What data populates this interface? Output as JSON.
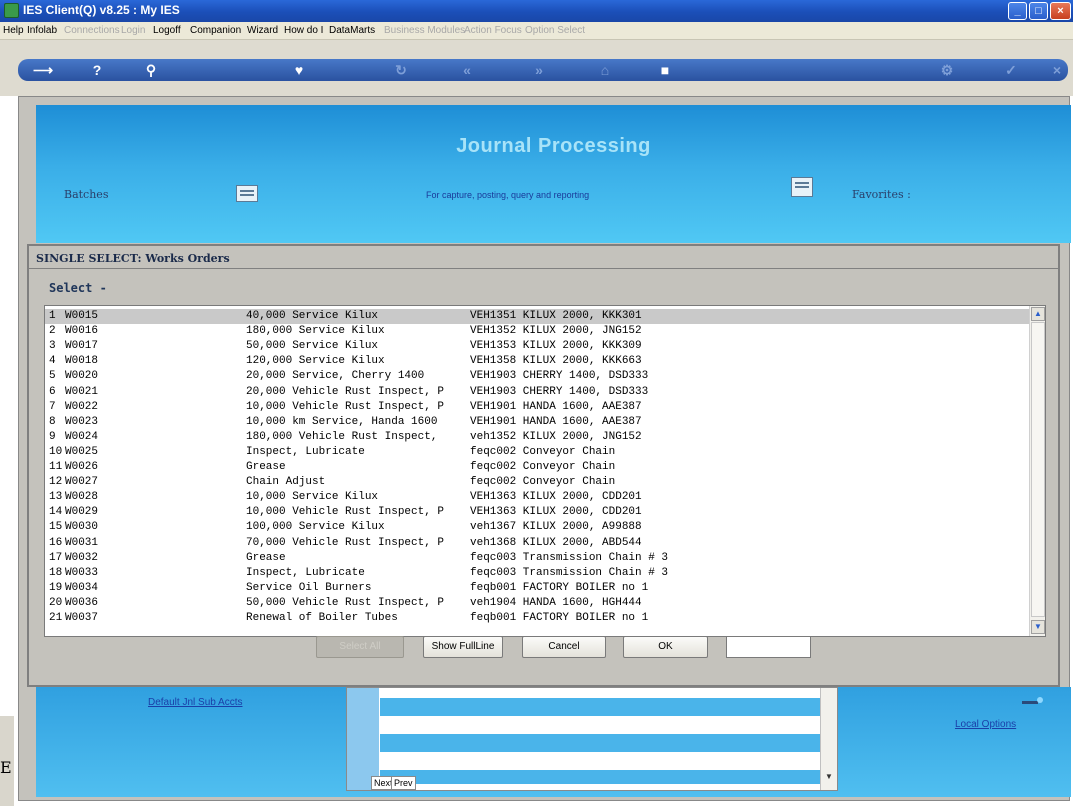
{
  "window": {
    "title": "IES Client(Q) v8.25 : My IES"
  },
  "menu": [
    {
      "label": "Help",
      "enabled": true
    },
    {
      "label": "Infolab",
      "enabled": true
    },
    {
      "label": "Connections",
      "enabled": false
    },
    {
      "label": "Login",
      "enabled": false
    },
    {
      "label": "Logoff",
      "enabled": true
    },
    {
      "label": "Companion",
      "enabled": true
    },
    {
      "label": "Wizard",
      "enabled": true
    },
    {
      "label": "How do I",
      "enabled": true
    },
    {
      "label": "DataMarts",
      "enabled": true
    },
    {
      "label": "Business Modules",
      "enabled": false
    },
    {
      "label": "Action Focus",
      "enabled": false
    },
    {
      "label": "Option Select",
      "enabled": false
    }
  ],
  "toolbar_icons": [
    "arrow-icon",
    "help-icon",
    "search-icon",
    "heart-icon",
    "refresh-icon",
    "back-icon",
    "forward-icon",
    "home-icon",
    "stop-icon",
    "settings-icon",
    "check-icon",
    "close-icon"
  ],
  "banner": {
    "heading": "Journal Processing",
    "batches": "Batches",
    "subtitle": "For capture, posting, query and reporting",
    "favorites": "Favorites :"
  },
  "dialog": {
    "title": "SINGLE SELECT: Works Orders",
    "select_label": "Select -",
    "rows": [
      {
        "n": "1",
        "code": "W0015",
        "desc": "40,000 Service Kilux",
        "ref": "VEH1351 KILUX 2000, KKK301"
      },
      {
        "n": "2",
        "code": "W0016",
        "desc": "180,000 Service Kilux",
        "ref": "VEH1352 KILUX 2000, JNG152"
      },
      {
        "n": "3",
        "code": "W0017",
        "desc": "50,000 Service Kilux",
        "ref": "VEH1353 KILUX 2000, KKK309"
      },
      {
        "n": "4",
        "code": "W0018",
        "desc": "120,000 Service Kilux",
        "ref": "VEH1358 KILUX 2000, KKK663"
      },
      {
        "n": "5",
        "code": "W0020",
        "desc": "20,000 Service, Cherry 1400",
        "ref": "VEH1903 CHERRY 1400, DSD333"
      },
      {
        "n": "6",
        "code": "W0021",
        "desc": "20,000 Vehicle Rust Inspect, P",
        "ref": "VEH1903 CHERRY 1400, DSD333"
      },
      {
        "n": "7",
        "code": "W0022",
        "desc": "10,000 Vehicle Rust Inspect, P",
        "ref": "VEH1901 HANDA 1600, AAE387"
      },
      {
        "n": "8",
        "code": "W0023",
        "desc": "10,000 km Service, Handa 1600",
        "ref": "VEH1901 HANDA 1600, AAE387"
      },
      {
        "n": "9",
        "code": "W0024",
        "desc": "180,000 Vehicle Rust Inspect,",
        "ref": "veh1352 KILUX 2000, JNG152"
      },
      {
        "n": "10",
        "code": "W0025",
        "desc": "Inspect, Lubricate",
        "ref": "feqc002 Conveyor Chain"
      },
      {
        "n": "11",
        "code": "W0026",
        "desc": "Grease",
        "ref": "feqc002 Conveyor Chain"
      },
      {
        "n": "12",
        "code": "W0027",
        "desc": "Chain Adjust",
        "ref": "feqc002 Conveyor Chain"
      },
      {
        "n": "13",
        "code": "W0028",
        "desc": "10,000 Service Kilux",
        "ref": "VEH1363 KILUX 2000, CDD201"
      },
      {
        "n": "14",
        "code": "W0029",
        "desc": "10,000 Vehicle Rust Inspect, P",
        "ref": "VEH1363 KILUX 2000, CDD201"
      },
      {
        "n": "15",
        "code": "W0030",
        "desc": "100,000 Service Kilux",
        "ref": "veh1367 KILUX 2000, A99888"
      },
      {
        "n": "16",
        "code": "W0031",
        "desc": "70,000 Vehicle Rust Inspect, P",
        "ref": "veh1368 KILUX 2000, ABD544"
      },
      {
        "n": "17",
        "code": "W0032",
        "desc": "Grease",
        "ref": "feqc003 Transmission Chain # 3"
      },
      {
        "n": "18",
        "code": "W0033",
        "desc": "Inspect, Lubricate",
        "ref": "feqc003 Transmission Chain # 3"
      },
      {
        "n": "19",
        "code": "W0034",
        "desc": "Service Oil Burners",
        "ref": "feqb001 FACTORY BOILER no 1"
      },
      {
        "n": "20",
        "code": "W0036",
        "desc": "50,000 Vehicle Rust Inspect, P",
        "ref": "veh1904 HANDA 1600, HGH444"
      },
      {
        "n": "21",
        "code": "W0037",
        "desc": "Renewal of Boiler Tubes",
        "ref": "feqb001 FACTORY BOILER no 1"
      }
    ],
    "buttons": {
      "disabled_label": "Select All",
      "show_full_line": "Show FullLine",
      "cancel": "Cancel",
      "ok": "OK"
    }
  },
  "bottom": {
    "default_link": "Default Jnl Sub Accts",
    "local_options": "Local Options",
    "tag_left": "Next",
    "tag_right": "Prev",
    "left_letter": "E"
  }
}
